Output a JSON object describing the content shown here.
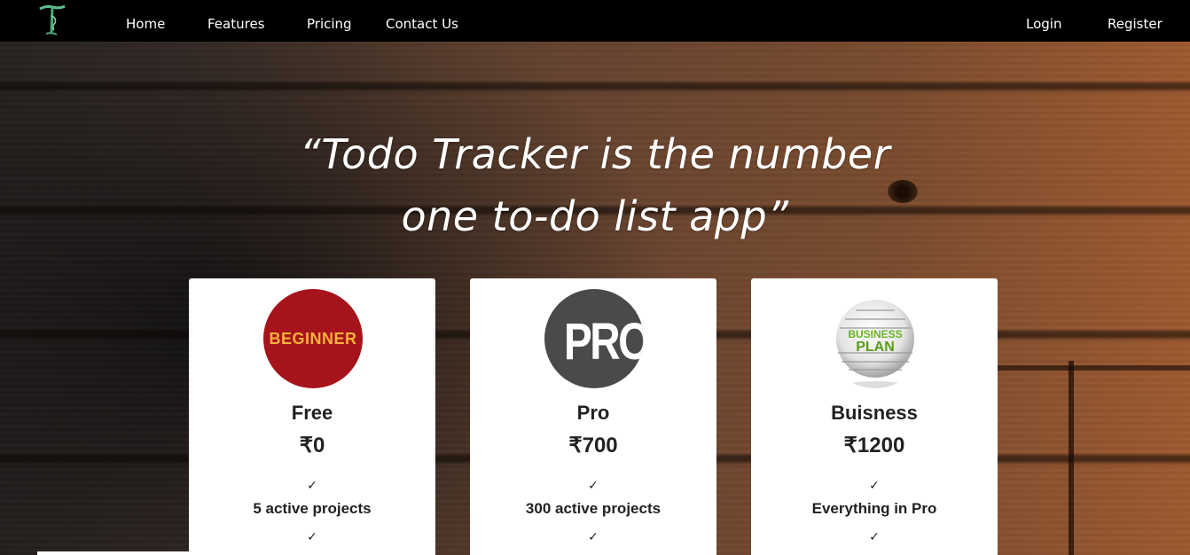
{
  "nav": {
    "logo_icon": "todo-tracker-logo-icon",
    "links": [
      "Home",
      "Features",
      "Pricing",
      "Contact Us"
    ],
    "login": "Login",
    "register": "Register"
  },
  "hero": {
    "tagline_line1": "“Todo Tracker is the number",
    "tagline_line2": "one to-do list app”"
  },
  "plans": [
    {
      "badge_text": "BEGINNER",
      "name": "Free",
      "price": "₹0",
      "features": [
        "5 active projects"
      ],
      "check": "✓"
    },
    {
      "badge_text": "PRO",
      "name": "Pro",
      "price": "₹700",
      "features": [
        "300 active projects"
      ],
      "check": "✓"
    },
    {
      "badge_text": "BUSINESS PLAN",
      "name": "Buisness",
      "price": "₹1200",
      "features": [
        "Everything in Pro"
      ],
      "check": "✓"
    }
  ],
  "colors": {
    "nav_bg": "#000000",
    "beginner_badge": "#a5141b",
    "beginner_text": "#f7b23b",
    "pro_badge": "#4a4a4a",
    "business_green": "#6ab023"
  }
}
